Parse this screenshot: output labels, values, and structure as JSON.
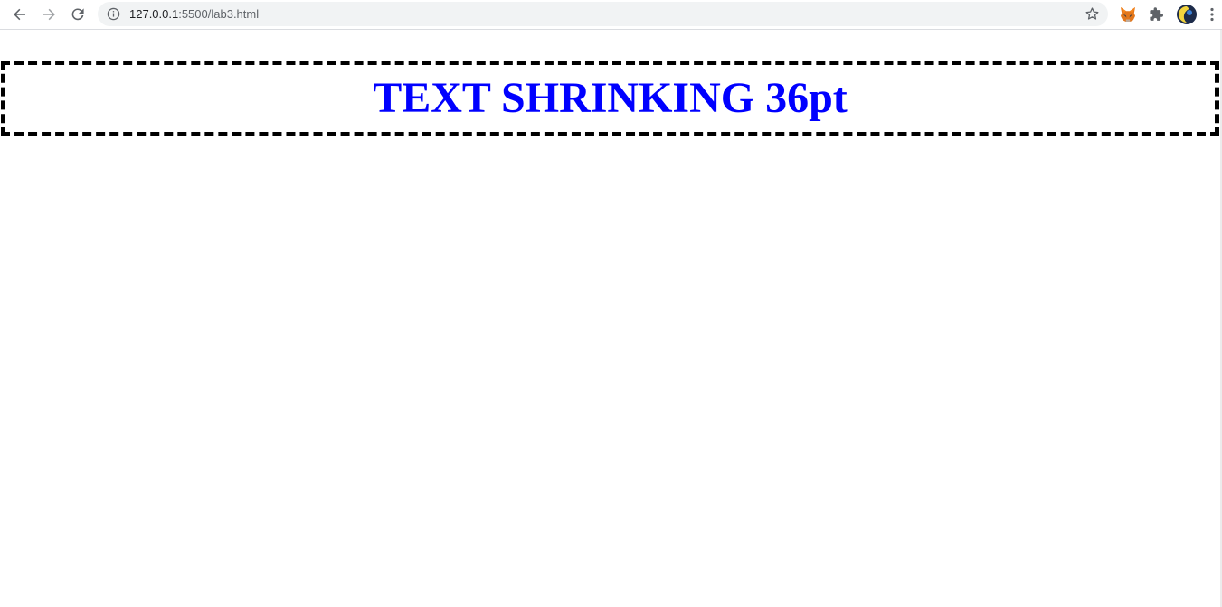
{
  "browser": {
    "url_host": "127.0.0.1",
    "url_path": ":5500/lab3.html",
    "icons": {
      "back": "back-arrow-icon",
      "forward": "forward-arrow-icon",
      "reload": "reload-icon",
      "info": "info-icon",
      "bookmark": "star-icon",
      "metamask": "fox-icon",
      "extensions": "puzzle-icon",
      "profile": "avatar",
      "menu": "kebab-menu-icon"
    }
  },
  "page": {
    "heading": "TEXT SHRINKING 36pt",
    "heading_color": "#0000ff",
    "border_color": "#000000",
    "border_style": "dashed"
  }
}
